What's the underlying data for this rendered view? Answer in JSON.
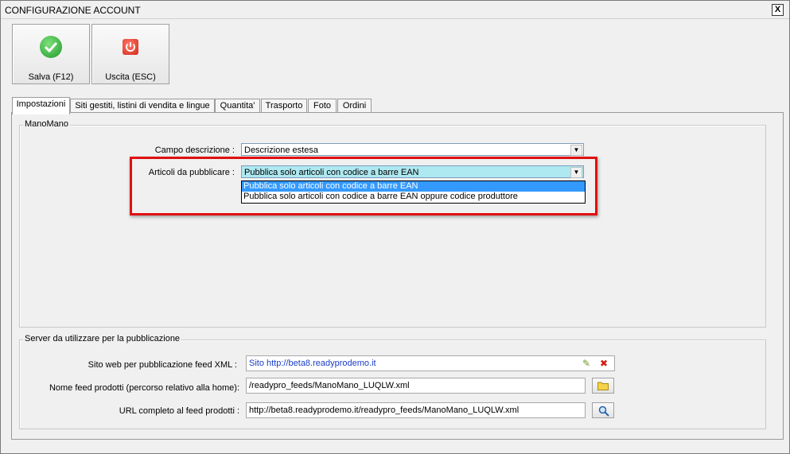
{
  "window": {
    "title": "CONFIGURAZIONE ACCOUNT",
    "close_label": "X"
  },
  "toolbar": {
    "save_label": "Salva (F12)",
    "exit_label": "Uscita (ESC)",
    "save_icon": "checkmark-icon",
    "exit_icon": "power-icon"
  },
  "tabs": [
    {
      "label": "Impostazioni",
      "active": true
    },
    {
      "label": "Siti gestiti, listini di vendita e lingue",
      "active": false
    },
    {
      "label": "Quantita'",
      "active": false
    },
    {
      "label": "Trasporto",
      "active": false
    },
    {
      "label": "Foto",
      "active": false
    },
    {
      "label": "Ordini",
      "active": false
    }
  ],
  "manomano": {
    "group_title": "ManoMano",
    "descrizione_label": "Campo descrizione :",
    "descrizione_value": "Descrizione estesa",
    "articoli_label": "Articoli da pubblicare :",
    "articoli_value": "Pubblica solo articoli con codice a barre EAN",
    "articoli_options": [
      "Pubblica solo articoli con codice a barre EAN",
      "Pubblica solo articoli con codice a barre EAN oppure codice produttore"
    ],
    "highlight_color": "#e01010"
  },
  "server": {
    "group_title": "Server da utilizzare per la pubblicazione",
    "sito_label": "Sito web per pubblicazione feed XML :",
    "sito_value": "Sito http://beta8.readyprodemo.it",
    "nome_label": "Nome feed prodotti (percorso relativo alla home):",
    "nome_value": "/readypro_feeds/ManoMano_LUQLW.xml",
    "url_label": "URL completo al feed prodotti :",
    "url_value": "http://beta8.readyprodemo.it/readypro_feeds/ManoMano_LUQLW.xml"
  }
}
